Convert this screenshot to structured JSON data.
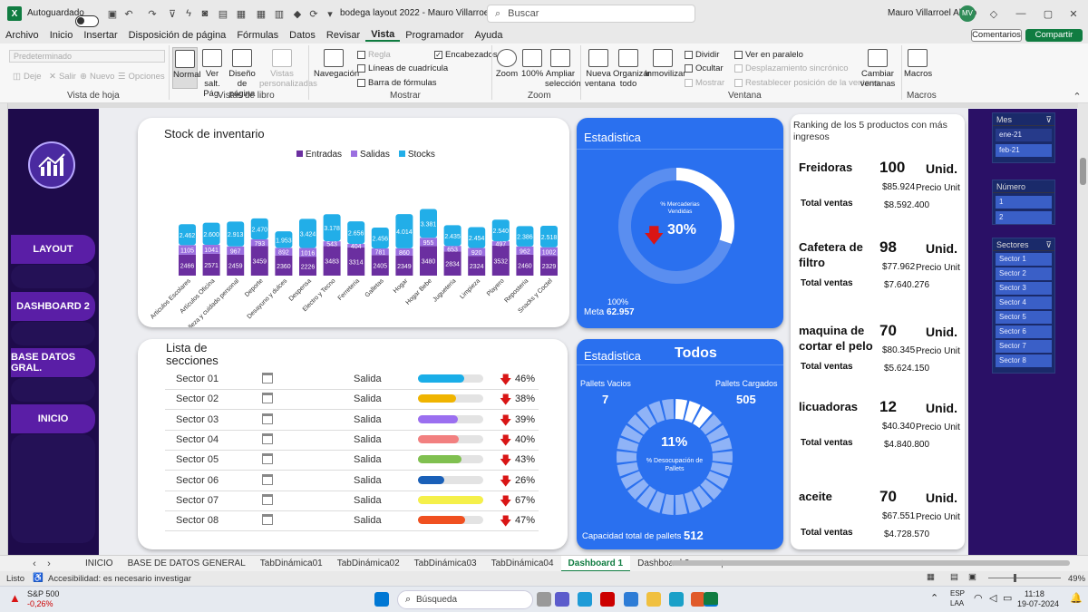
{
  "titlebar": {
    "autosave_label": "Autoguardado",
    "file_title": "bodega layout 2022 - Mauro Villarroel  -  E...",
    "search_placeholder": "Buscar",
    "user_name": "Mauro Villarroel Alfaro",
    "user_initials": "MV"
  },
  "menu": [
    "Archivo",
    "Inicio",
    "Insertar",
    "Disposición de página",
    "Fórmulas",
    "Datos",
    "Revisar",
    "Vista",
    "Programador",
    "Ayuda"
  ],
  "menu_active": "Vista",
  "comments_label": "Comentarios",
  "share_label": "Compartir",
  "ribbon": {
    "sheet_view": {
      "dropdown": "Predeterminado",
      "keep": "Deje",
      "exit": "Salir",
      "new": "Nuevo",
      "options": "Opciones",
      "label": "Vista de hoja"
    },
    "book_views": {
      "normal": "Normal",
      "page_break": "Ver salt. Pág.",
      "page_layout": "Diseño de página",
      "custom": "Vistas personalizadas",
      "label": "Vistas de libro"
    },
    "show": {
      "navigation": "Navegación",
      "ruler": "Regla",
      "gridlines": "Líneas de cuadrícula",
      "formula_bar": "Barra de fórmulas",
      "headings": "Encabezados",
      "label": "Mostrar"
    },
    "zoom": {
      "zoom": "Zoom",
      "pct100": "100%",
      "to_selection": "Ampliar selección",
      "label": "Zoom"
    },
    "window": {
      "new_window": "Nueva ventana",
      "arrange": "Organizar todo",
      "freeze": "Inmovilizar",
      "split": "Dividir",
      "hide": "Ocultar",
      "unhide": "Mostrar",
      "side_by_side": "Ver en paralelo",
      "sync_scroll": "Desplazamiento sincrónico",
      "reset_pos": "Restablecer posición de la ventana",
      "switch": "Cambiar ventanas",
      "label": "Ventana"
    },
    "macros": {
      "macros": "Macros",
      "label": "Macros"
    }
  },
  "nav": [
    "LAYOUT",
    "DASHBOARD 2",
    "BASE DATOS GRAL.",
    "INICIO"
  ],
  "stock_card": {
    "title": "Stock de inventario",
    "legend": [
      "Entradas",
      "Salidas",
      "Stocks"
    ]
  },
  "chart_data": {
    "type": "bar",
    "stacked": true,
    "categories": [
      "Articulos Escolares",
      "Artículos Oficina",
      "Belleza y cuidado personal",
      "Deporte",
      "Desayuno y dulces",
      "Despensa",
      "Electro y Tecno",
      "Ferreteria",
      "Galletas",
      "Hogar",
      "Hogar Bebe",
      "Jugueteria",
      "Limpieza",
      "Playero",
      "Reposteria",
      "Snacks y Coctel"
    ],
    "series": [
      {
        "name": "Entradas",
        "color": "#6b2fa0",
        "values": [
          2466,
          2571,
          2459,
          3459,
          2360,
          2226,
          3483,
          3314,
          2405,
          2349,
          3480,
          2834,
          2324,
          3532,
          2460,
          2329
        ]
      },
      {
        "name": "Salidas",
        "color": "#9b6fe0",
        "values": [
          1105,
          1041,
          967,
          793,
          892,
          1016,
          543,
          404,
          781,
          860,
          955,
          653,
          920,
          497,
          962,
          1002
        ]
      },
      {
        "name": "Stocks",
        "color": "#22aee8",
        "values": [
          2462,
          2600,
          2913,
          2470,
          1953,
          3424,
          3178,
          2656,
          2456,
          4014,
          3381,
          2435,
          2454,
          2540,
          2386,
          2518
        ]
      }
    ],
    "value_labels": [
      [
        "2466",
        "2571",
        "2459",
        "3459",
        "2360",
        "2226",
        "3483",
        "3314",
        "2405",
        "2349",
        "3480",
        "2834",
        "2324",
        "3532",
        "2460",
        "2329"
      ],
      [
        "1105",
        "1041",
        "967",
        "793",
        "892",
        "1016",
        "543",
        "404",
        "781",
        "860",
        "955",
        "653",
        "920",
        "497",
        "962",
        "1002"
      ],
      [
        "2.462",
        "2.600",
        "2.913",
        "2.470",
        "1.953",
        "3.424",
        "3.178",
        "2.656",
        "2.456",
        "4.014",
        "3.381",
        "2.435",
        "2.454",
        "2.540",
        "2.386",
        "2.518"
      ]
    ]
  },
  "stats1": {
    "title": "Estadistica",
    "donut_label": "% Mercaderias Vendidas",
    "pct": "30%",
    "pct_value": 0.3,
    "target_pct": "100%",
    "goal_label": "Meta",
    "goal_value": "62.957"
  },
  "sections": {
    "title": "Lista de secciones",
    "rows": [
      {
        "name": "Sector 01",
        "kind": "Salida",
        "pct": "46%",
        "value": 0.46,
        "color": "#1aaee8"
      },
      {
        "name": "Sector 02",
        "kind": "Salida",
        "pct": "38%",
        "value": 0.38,
        "color": "#f0b400"
      },
      {
        "name": "Sector 03",
        "kind": "Salida",
        "pct": "39%",
        "value": 0.39,
        "color": "#9b6ff0"
      },
      {
        "name": "Sector 04",
        "kind": "Salida",
        "pct": "40%",
        "value": 0.4,
        "color": "#f28080"
      },
      {
        "name": "Sector 05",
        "kind": "Salida",
        "pct": "43%",
        "value": 0.43,
        "color": "#80c050"
      },
      {
        "name": "Sector 06",
        "kind": "Salida",
        "pct": "26%",
        "value": 0.26,
        "color": "#1a60b8"
      },
      {
        "name": "Sector 07",
        "kind": "Salida",
        "pct": "67%",
        "value": 0.67,
        "color": "#f5f04a"
      },
      {
        "name": "Sector 08",
        "kind": "Salida",
        "pct": "47%",
        "value": 0.47,
        "color": "#f05020"
      }
    ]
  },
  "stats2": {
    "title": "Estadistica",
    "filter": "Todos",
    "empty_label": "Pallets Vacios",
    "empty_value": "7",
    "loaded_label": "Pallets Cargados",
    "loaded_value": "505",
    "pct": "11%",
    "pct_value": 0.11,
    "desc": "% Desocupación de Pallets",
    "capacity_label": "Capacidad total de pallets",
    "capacity_value": "512"
  },
  "ranking": {
    "title": "Ranking de los 5 productos con más ingresos",
    "unit_label": "Unid.",
    "price_label": "Precio Unit",
    "total_label": "Total ventas",
    "items": [
      {
        "name": "Freidoras",
        "qty": "100",
        "price": "$85.924",
        "total": "$8.592.400"
      },
      {
        "name": "Cafetera de filtro",
        "qty": "98",
        "price": "$77.962",
        "total": "$7.640.276"
      },
      {
        "name": "maquina de cortar el pelo",
        "qty": "70",
        "price": "$80.345",
        "total": "$5.624.150"
      },
      {
        "name": "licuadoras",
        "qty": "12",
        "price": "$40.340",
        "total": "$4.840.800"
      },
      {
        "name": "aceite",
        "qty": "70",
        "price": "$67.551",
        "total": "$4.728.570"
      }
    ]
  },
  "slicers": {
    "mes": {
      "title": "Mes",
      "items": [
        "ene-21",
        "feb-21"
      ]
    },
    "numero": {
      "title": "Número",
      "items": [
        "1",
        "2"
      ]
    },
    "sectores": {
      "title": "Sectores",
      "items": [
        "Sector 1",
        "Sector 2",
        "Sector 3",
        "Sector 4",
        "Sector 5",
        "Sector 6",
        "Sector 7",
        "Sector 8"
      ]
    }
  },
  "sheet_tabs": [
    "INICIO",
    "BASE DE DATOS GENERAL",
    "TabDinámica01",
    "TabDinámica02",
    "TabDinámica03",
    "TabDinámica04",
    "Dashboard 1",
    "Dashboard 2"
  ],
  "active_tab": "Dashboard 1",
  "status": {
    "ready": "Listo",
    "accessibility": "Accesibilidad: es necesario investigar",
    "zoom": "49%"
  },
  "taskbar": {
    "stock_name": "S&P 500",
    "stock_change": "-0,26%",
    "search": "Búsqueda",
    "lang1": "ESP",
    "lang2": "LAA",
    "time": "11:18",
    "date": "19-07-2024"
  }
}
